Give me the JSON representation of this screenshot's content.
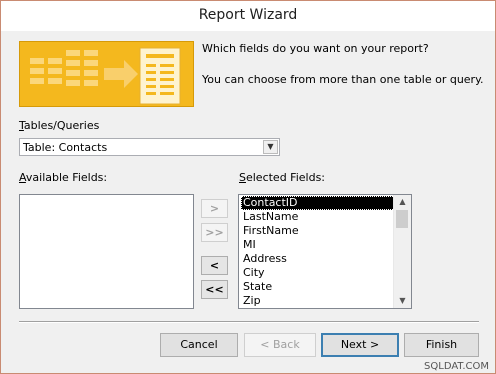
{
  "window": {
    "title": "Report Wizard"
  },
  "header": {
    "prompt": "Which fields do you want on your report?",
    "hint": "You can choose from more than one table or query."
  },
  "source": {
    "label_u": "T",
    "label_rest": "ables/Queries",
    "selected": "Table: Contacts"
  },
  "available": {
    "label_u": "A",
    "label_rest": "vailable Fields:",
    "items": []
  },
  "selected_fields": {
    "label_u": "S",
    "label_rest": "elected Fields:",
    "items": [
      "ContactID",
      "LastName",
      "FirstName",
      "MI",
      "Address",
      "City",
      "State",
      "Zip"
    ]
  },
  "move_buttons": {
    "add_one": ">",
    "add_all": ">>",
    "remove_one": "<",
    "remove_all": "<<"
  },
  "footer": {
    "cancel": "Cancel",
    "back": "< Back",
    "next": "Next >",
    "finish": "Finish"
  },
  "watermark": "SQLDAT.COM",
  "colors": {
    "graphic": "#f4b81e",
    "default_button_border": "#3c7fb1"
  }
}
